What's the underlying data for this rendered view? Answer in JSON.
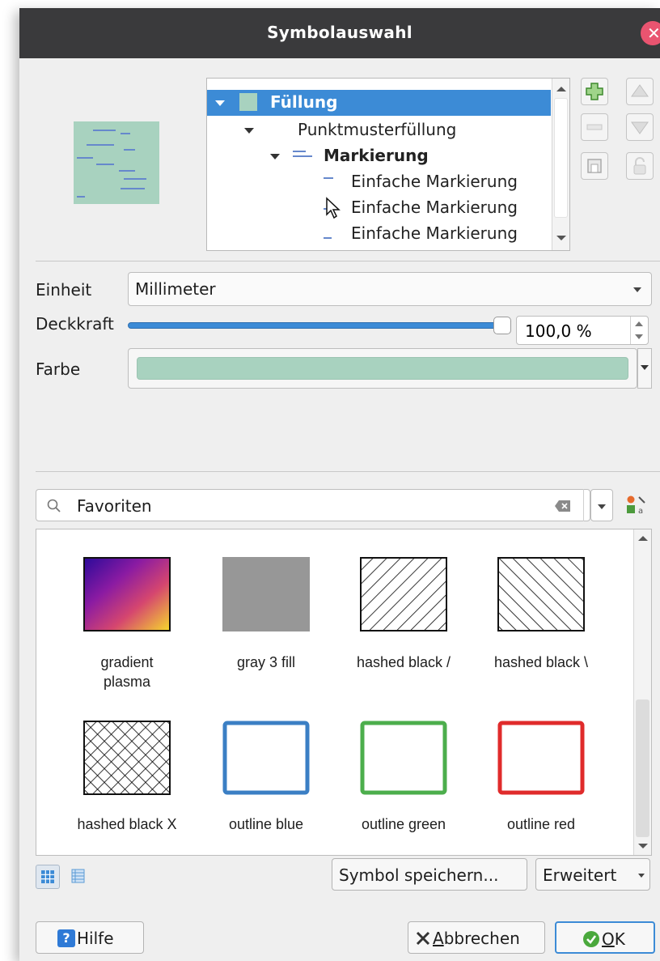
{
  "dialog": {
    "title": "Symbolauswahl"
  },
  "tree": {
    "items": [
      {
        "label": "Füllung",
        "selected": true
      },
      {
        "label": "Punktmusterfüllung"
      },
      {
        "label": "Markierung"
      },
      {
        "label": "Einfache Markierung"
      },
      {
        "label": "Einfache Markierung"
      },
      {
        "label": "Einfache Markierung"
      }
    ]
  },
  "properties": {
    "unit_label": "Einheit",
    "unit_value": "Millimeter",
    "opacity_label": "Deckkraft",
    "opacity_value": "100,0 %",
    "opacity_fraction": 1.0,
    "color_label": "Farbe",
    "fill_color": "#a8d2bf"
  },
  "library": {
    "search_value": "Favoriten",
    "symbols": [
      {
        "label": "gradient plasma",
        "line1": "gradient",
        "line2": "plasma"
      },
      {
        "label": "gray 3 fill",
        "line1": "gray 3 fill",
        "line2": ""
      },
      {
        "label": "hashed black /",
        "line1": "hashed black /",
        "line2": ""
      },
      {
        "label": "hashed black \\",
        "line1": "hashed black \\",
        "line2": ""
      },
      {
        "label": "hashed black X",
        "line1": "hashed black X",
        "line2": ""
      },
      {
        "label": "outline blue",
        "line1": "outline blue",
        "line2": "",
        "color": "#3b7fc4"
      },
      {
        "label": "outline green",
        "line1": "outline green",
        "line2": "",
        "color": "#4cae4c"
      },
      {
        "label": "outline red",
        "line1": "outline red",
        "line2": "",
        "color": "#e02b2b"
      }
    ]
  },
  "buttons": {
    "save_symbol": "Symbol speichern...",
    "advanced": "Erweitert",
    "help": "Hilfe",
    "cancel_rest": "bbrechen",
    "cancel_mnemonic": "A",
    "ok_rest": "K",
    "ok_mnemonic": "O"
  }
}
